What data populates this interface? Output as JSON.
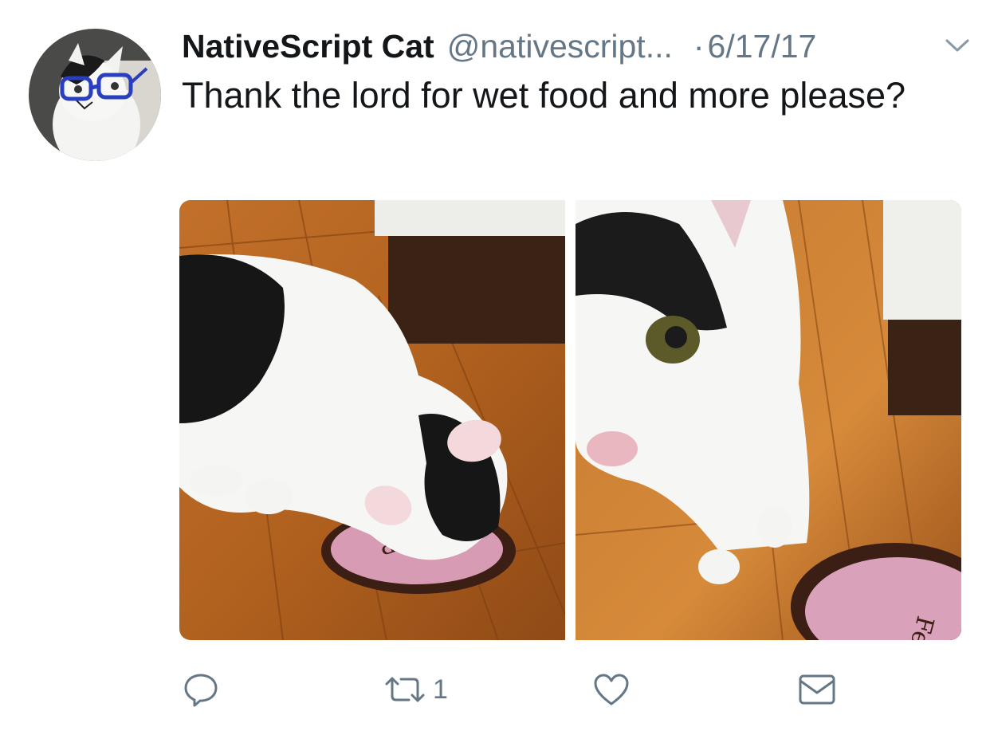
{
  "tweet": {
    "display_name": "NativeScript Cat",
    "handle": "@nativescript...",
    "separator": "·",
    "date": "6/17/17",
    "text": "Thank the lord for wet food and more please?"
  },
  "actions": {
    "reply_icon": "reply-icon",
    "retweet_icon": "retweet-icon",
    "retweet_count": "1",
    "like_icon": "heart-icon",
    "dm_icon": "envelope-icon"
  },
  "media": {
    "bowl_text_right": "Feed Me",
    "bowl_text_left": "P"
  },
  "colors": {
    "text": "#14171a",
    "secondary": "#657786",
    "action_icon": "#657786"
  }
}
